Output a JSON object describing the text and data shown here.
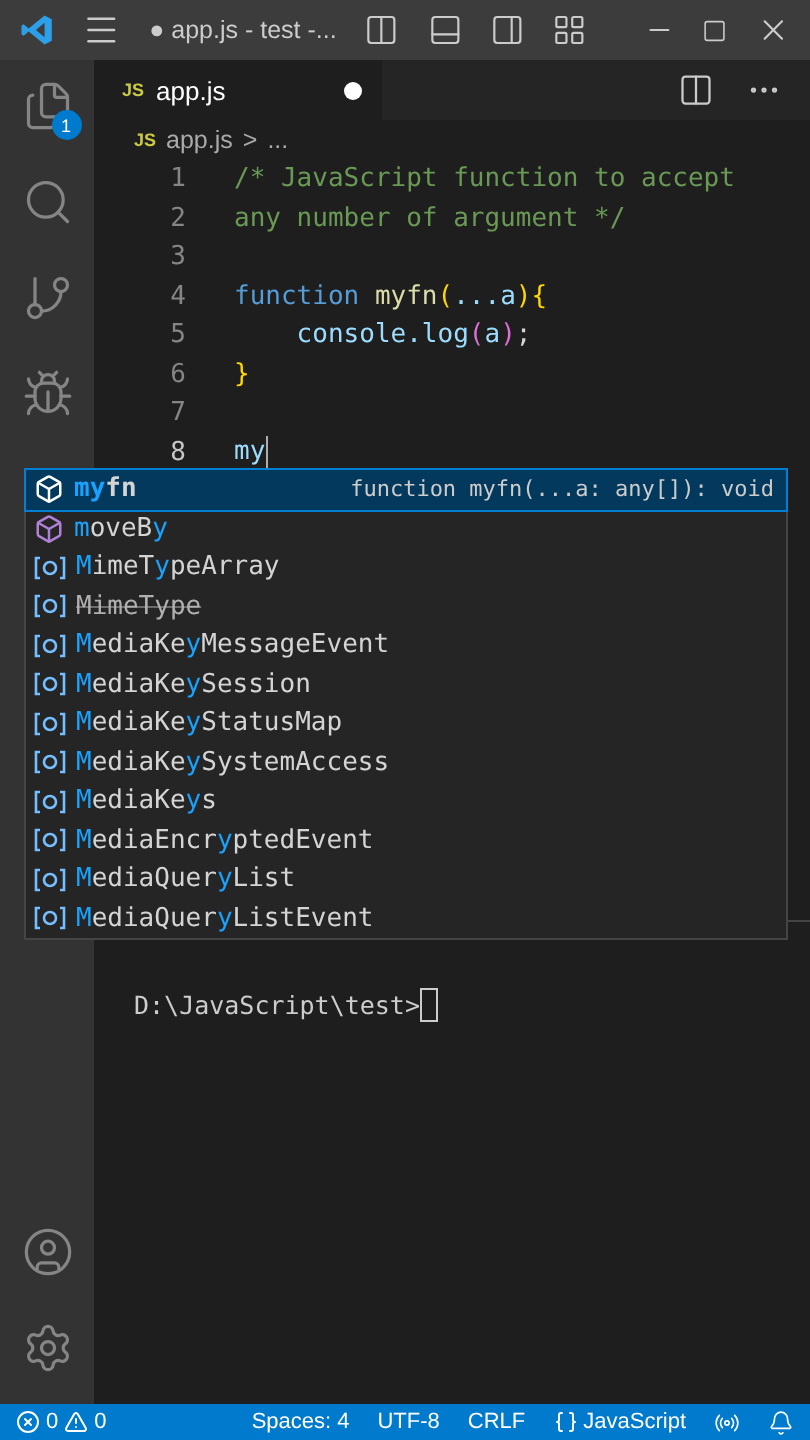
{
  "title_bar": {
    "title": "● app.js - test -..."
  },
  "activity_bar": {
    "badge": "1"
  },
  "tabs": [
    {
      "icon_text": "JS",
      "label": "app.js",
      "selected": true,
      "modified": true
    }
  ],
  "breadcrumb": {
    "icon_text": "JS",
    "file": "app.js",
    "separator": ">",
    "rest": "..."
  },
  "code_lines": [
    {
      "number": "1",
      "tokens": [
        {
          "text": "/* JavaScript function to accept",
          "kind": "comment"
        }
      ]
    },
    {
      "number": "2",
      "tokens": [
        {
          "text": "any number of argument */",
          "kind": "comment"
        }
      ]
    },
    {
      "number": "3"
    },
    {
      "number": "4",
      "tokens": [
        {
          "text": "function ",
          "kind": "keyword"
        },
        {
          "text": "myfn",
          "kind": "function"
        },
        {
          "text": "(",
          "kind": "bracket"
        },
        {
          "text": "...a",
          "kind": "variable"
        },
        {
          "text": "){",
          "kind": "bracket"
        }
      ]
    },
    {
      "number": "5",
      "tokens": [
        {
          "text": "    console.log",
          "kind": "variable"
        },
        {
          "text": "(",
          "kind": "bracket2"
        },
        {
          "text": "a",
          "kind": "variable"
        },
        {
          "text": ")",
          "kind": "bracket2"
        },
        {
          "text": ";",
          "kind": "plain"
        }
      ]
    },
    {
      "number": "6",
      "tokens": [
        {
          "text": "}",
          "kind": "bracket"
        }
      ]
    },
    {
      "number": "7"
    },
    {
      "number": "8",
      "tokens": [
        {
          "text": "my",
          "kind": "variable"
        }
      ],
      "cursor": true
    }
  ],
  "suggestions": [
    {
      "kind": "method",
      "selected": true,
      "deprecated": false,
      "parts": [
        {
          "text": "my",
          "match": true
        },
        {
          "text": "fn",
          "match": false
        }
      ],
      "detail": "function myfn(...a: any[]): void"
    },
    {
      "kind": "method",
      "selected": false,
      "deprecated": false,
      "parts": [
        {
          "text": "m",
          "match": true
        },
        {
          "text": "oveB",
          "match": false
        },
        {
          "text": "y",
          "match": true
        }
      ]
    },
    {
      "kind": "variable",
      "selected": false,
      "deprecated": false,
      "parts": [
        {
          "text": "M",
          "match": true
        },
        {
          "text": "imeT",
          "match": false
        },
        {
          "text": "y",
          "match": true
        },
        {
          "text": "peArray",
          "match": false
        }
      ]
    },
    {
      "kind": "variable",
      "selected": false,
      "deprecated": true,
      "parts": [
        {
          "text": "MimeType",
          "match": false
        }
      ]
    },
    {
      "kind": "variable",
      "selected": false,
      "deprecated": false,
      "parts": [
        {
          "text": "M",
          "match": true
        },
        {
          "text": "ediaKe",
          "match": false
        },
        {
          "text": "y",
          "match": true
        },
        {
          "text": "MessageEvent",
          "match": false
        }
      ]
    },
    {
      "kind": "variable",
      "selected": false,
      "deprecated": false,
      "parts": [
        {
          "text": "M",
          "match": true
        },
        {
          "text": "ediaKe",
          "match": false
        },
        {
          "text": "y",
          "match": true
        },
        {
          "text": "Session",
          "match": false
        }
      ]
    },
    {
      "kind": "variable",
      "selected": false,
      "deprecated": false,
      "parts": [
        {
          "text": "M",
          "match": true
        },
        {
          "text": "ediaKe",
          "match": false
        },
        {
          "text": "y",
          "match": true
        },
        {
          "text": "StatusMap",
          "match": false
        }
      ]
    },
    {
      "kind": "variable",
      "selected": false,
      "deprecated": false,
      "parts": [
        {
          "text": "M",
          "match": true
        },
        {
          "text": "ediaKe",
          "match": false
        },
        {
          "text": "y",
          "match": true
        },
        {
          "text": "SystemAccess",
          "match": false
        }
      ]
    },
    {
      "kind": "variable",
      "selected": false,
      "deprecated": false,
      "parts": [
        {
          "text": "M",
          "match": true
        },
        {
          "text": "ediaKe",
          "match": false
        },
        {
          "text": "y",
          "match": true
        },
        {
          "text": "s",
          "match": false
        }
      ]
    },
    {
      "kind": "variable",
      "selected": false,
      "deprecated": false,
      "parts": [
        {
          "text": "M",
          "match": true
        },
        {
          "text": "ediaEncr",
          "match": false
        },
        {
          "text": "y",
          "match": true
        },
        {
          "text": "ptedEvent",
          "match": false
        }
      ]
    },
    {
      "kind": "variable",
      "selected": false,
      "deprecated": false,
      "parts": [
        {
          "text": "M",
          "match": true
        },
        {
          "text": "ediaQuer",
          "match": false
        },
        {
          "text": "y",
          "match": true
        },
        {
          "text": "List",
          "match": false
        }
      ]
    },
    {
      "kind": "variable",
      "selected": false,
      "deprecated": false,
      "parts": [
        {
          "text": "M",
          "match": true
        },
        {
          "text": "ediaQuer",
          "match": false
        },
        {
          "text": "y",
          "match": true
        },
        {
          "text": "ListEvent",
          "match": false
        }
      ]
    }
  ],
  "terminal": {
    "prompt": "D:\\JavaScript\\test>"
  },
  "status_bar": {
    "errors": "0",
    "warnings": "0",
    "items": [
      "Spaces: 4",
      "UTF-8",
      "CRLF"
    ],
    "language": "JavaScript"
  }
}
